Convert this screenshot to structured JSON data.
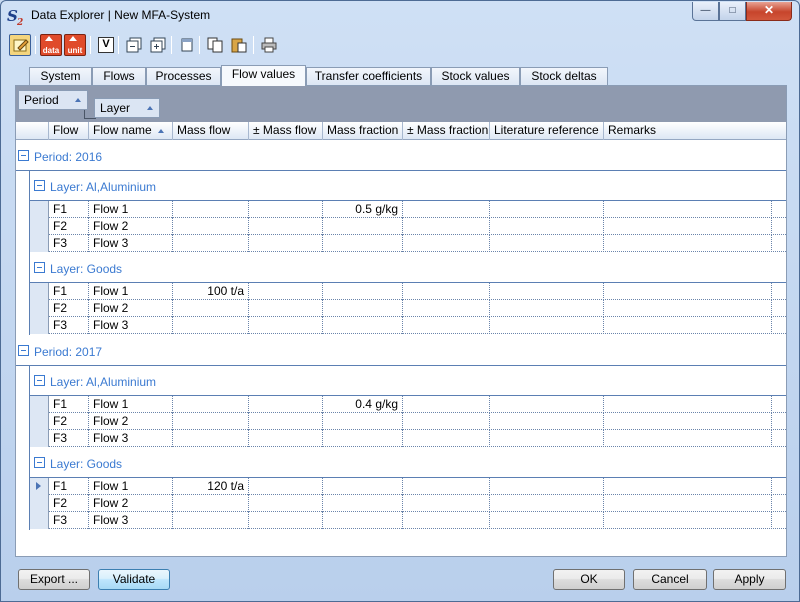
{
  "window": {
    "title": "Data Explorer | New MFA-System",
    "app_icon_text": "S",
    "app_icon_sub": "2",
    "minimize_glyph": "—",
    "maximize_glyph": "□",
    "close_glyph": "✕"
  },
  "toolbar": {
    "buttons": [
      {
        "icon": "edit-note-icon",
        "active": true
      },
      {
        "icon": "data-export-icon",
        "label": "data"
      },
      {
        "icon": "unit-export-icon",
        "label": "unit"
      },
      {
        "icon": "validate-icon",
        "glyph": "V"
      },
      {
        "icon": "collapse-all-icon"
      },
      {
        "icon": "expand-all-icon"
      },
      {
        "icon": "single-window-icon"
      },
      {
        "icon": "copy-icon"
      },
      {
        "icon": "paste-icon"
      },
      {
        "icon": "print-icon"
      }
    ]
  },
  "tabs": [
    {
      "label": "System",
      "selected": false
    },
    {
      "label": "Flows",
      "selected": false
    },
    {
      "label": "Processes",
      "selected": false
    },
    {
      "label": "Flow values",
      "selected": true
    },
    {
      "label": "Transfer coefficients",
      "selected": false
    },
    {
      "label": "Stock values",
      "selected": false
    },
    {
      "label": "Stock deltas",
      "selected": false
    }
  ],
  "group_by": [
    "Period",
    "Layer"
  ],
  "columns": [
    "Flow",
    "Flow name",
    "Mass flow",
    "± Mass flow",
    "Mass fraction",
    "± Mass fraction",
    "Literature reference",
    "Remarks"
  ],
  "sorted_column": "Flow name",
  "groups": [
    {
      "period_label": "Period: 2016",
      "layers": [
        {
          "layer_label": "Layer: Al,Aluminium",
          "rows": [
            {
              "flow": "F1",
              "name": "Flow 1",
              "mass_flow": "",
              "pm_mass_flow": "",
              "mass_fraction": "0.5 g/kg",
              "pm_mass_fraction": "",
              "lit_ref": "",
              "remarks": ""
            },
            {
              "flow": "F2",
              "name": "Flow 2",
              "mass_flow": "",
              "pm_mass_flow": "",
              "mass_fraction": "",
              "pm_mass_fraction": "",
              "lit_ref": "",
              "remarks": ""
            },
            {
              "flow": "F3",
              "name": "Flow 3",
              "mass_flow": "",
              "pm_mass_flow": "",
              "mass_fraction": "",
              "pm_mass_fraction": "",
              "lit_ref": "",
              "remarks": ""
            }
          ]
        },
        {
          "layer_label": "Layer: Goods",
          "rows": [
            {
              "flow": "F1",
              "name": "Flow 1",
              "mass_flow": "100 t/a",
              "pm_mass_flow": "",
              "mass_fraction": "",
              "pm_mass_fraction": "",
              "lit_ref": "",
              "remarks": ""
            },
            {
              "flow": "F2",
              "name": "Flow 2",
              "mass_flow": "",
              "pm_mass_flow": "",
              "mass_fraction": "",
              "pm_mass_fraction": "",
              "lit_ref": "",
              "remarks": ""
            },
            {
              "flow": "F3",
              "name": "Flow 3",
              "mass_flow": "",
              "pm_mass_flow": "",
              "mass_fraction": "",
              "pm_mass_fraction": "",
              "lit_ref": "",
              "remarks": ""
            }
          ]
        }
      ]
    },
    {
      "period_label": "Period: 2017",
      "layers": [
        {
          "layer_label": "Layer: Al,Aluminium",
          "rows": [
            {
              "flow": "F1",
              "name": "Flow 1",
              "mass_flow": "",
              "pm_mass_flow": "",
              "mass_fraction": "0.4 g/kg",
              "pm_mass_fraction": "",
              "lit_ref": "",
              "remarks": ""
            },
            {
              "flow": "F2",
              "name": "Flow 2",
              "mass_flow": "",
              "pm_mass_flow": "",
              "mass_fraction": "",
              "pm_mass_fraction": "",
              "lit_ref": "",
              "remarks": ""
            },
            {
              "flow": "F3",
              "name": "Flow 3",
              "mass_flow": "",
              "pm_mass_flow": "",
              "mass_fraction": "",
              "pm_mass_fraction": "",
              "lit_ref": "",
              "remarks": ""
            }
          ]
        },
        {
          "layer_label": "Layer: Goods",
          "rows": [
            {
              "flow": "F1",
              "name": "Flow 1",
              "mass_flow": "120 t/a",
              "pm_mass_flow": "",
              "mass_fraction": "",
              "pm_mass_fraction": "",
              "lit_ref": "",
              "remarks": "",
              "current": true
            },
            {
              "flow": "F2",
              "name": "Flow 2",
              "mass_flow": "",
              "pm_mass_flow": "",
              "mass_fraction": "",
              "pm_mass_fraction": "",
              "lit_ref": "",
              "remarks": ""
            },
            {
              "flow": "F3",
              "name": "Flow 3",
              "mass_flow": "",
              "pm_mass_flow": "",
              "mass_fraction": "",
              "pm_mass_fraction": "",
              "lit_ref": "",
              "remarks": ""
            }
          ]
        }
      ]
    }
  ],
  "buttons": {
    "export": "Export ...",
    "validate": "Validate",
    "ok": "OK",
    "cancel": "Cancel",
    "apply": "Apply"
  },
  "colors": {
    "group_text": "#3b7ad1",
    "group_line": "#5b7fb3",
    "groupbar_bg": "#8f9aaf"
  }
}
